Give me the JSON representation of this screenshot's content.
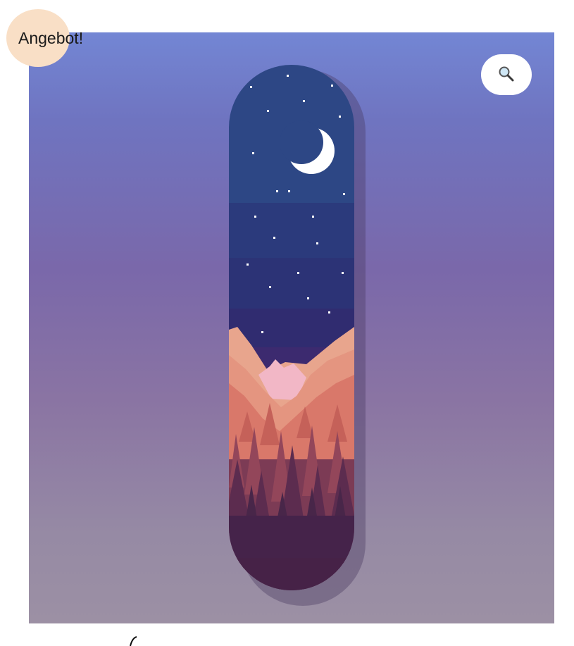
{
  "badge": {
    "label": "Angebot!",
    "color": "#f9dfc6"
  },
  "zoom_button": {
    "icon": "magnifier-icon",
    "aria_label": "zoom"
  },
  "product_image": {
    "subject": "skateboard-deck-pixel-night-mountains",
    "colors": {
      "background_top": "#7386d4",
      "background_bottom": "#9c90a4",
      "sky": "#2b4484",
      "mountain": "#d97a6a",
      "forest": "#4a2448"
    }
  }
}
